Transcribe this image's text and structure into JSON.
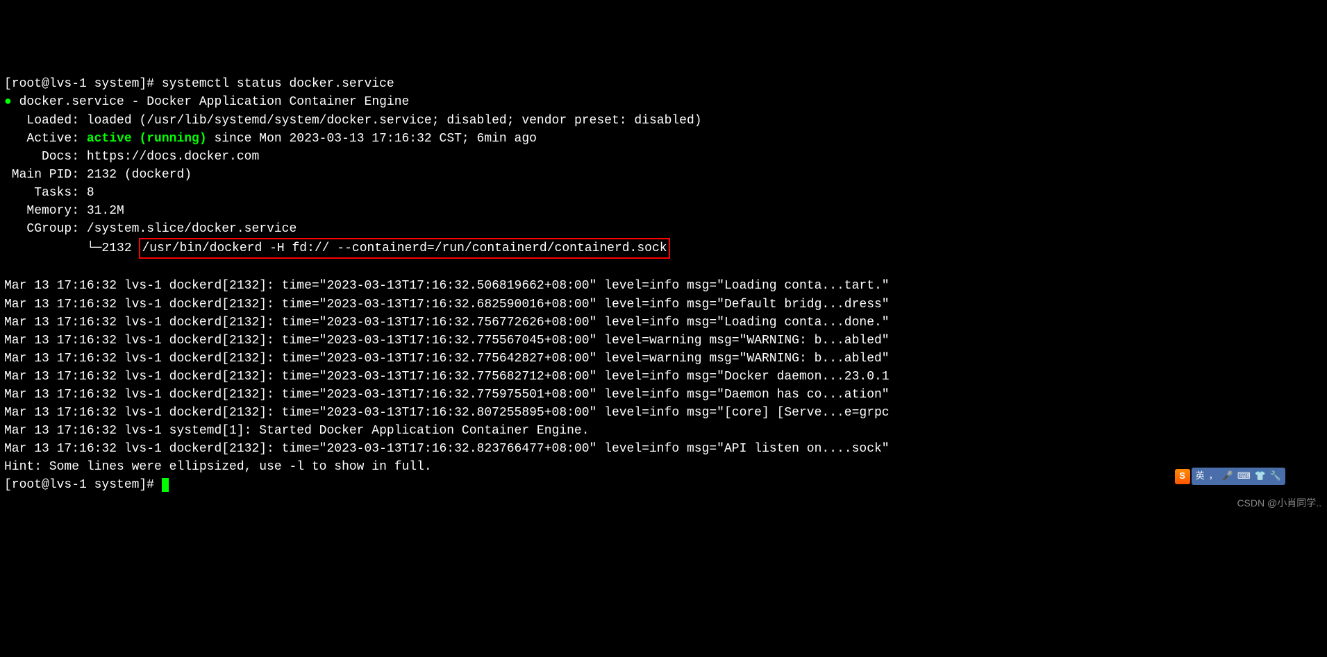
{
  "prompt1": "[root@lvs-1 system]# ",
  "cmd": "systemctl status docker.service",
  "bullet": "●",
  "svc_name": "docker.service",
  "svc_desc": " - Docker Application Container Engine",
  "loaded_lbl": "   Loaded: ",
  "loaded_val": "loaded (/usr/lib/systemd/system/docker.service; disabled; vendor preset: disabled)",
  "active_lbl": "   Active: ",
  "active_state": "active (running)",
  "active_since": " since Mon 2023-03-13 17:16:32 CST; 6min ago",
  "docs_lbl": "     Docs: ",
  "docs_val": "https://docs.docker.com",
  "pid_lbl": " Main PID: ",
  "pid_val": "2132 (dockerd)",
  "tasks_lbl": "    Tasks: ",
  "tasks_val": "8",
  "mem_lbl": "   Memory: ",
  "mem_val": "31.2M",
  "cgroup_lbl": "   CGroup: ",
  "cgroup_val": "/system.slice/docker.service",
  "tree_prefix": "           └─2132 ",
  "proc_cmd": "/usr/bin/dockerd -H fd:// --containerd=/run/containerd/containerd.sock",
  "logs": [
    "Mar 13 17:16:32 lvs-1 dockerd[2132]: time=\"2023-03-13T17:16:32.506819662+08:00\" level=info msg=\"Loading conta...tart.\"",
    "Mar 13 17:16:32 lvs-1 dockerd[2132]: time=\"2023-03-13T17:16:32.682590016+08:00\" level=info msg=\"Default bridg...dress\"",
    "Mar 13 17:16:32 lvs-1 dockerd[2132]: time=\"2023-03-13T17:16:32.756772626+08:00\" level=info msg=\"Loading conta...done.\"",
    "Mar 13 17:16:32 lvs-1 dockerd[2132]: time=\"2023-03-13T17:16:32.775567045+08:00\" level=warning msg=\"WARNING: b...abled\"",
    "Mar 13 17:16:32 lvs-1 dockerd[2132]: time=\"2023-03-13T17:16:32.775642827+08:00\" level=warning msg=\"WARNING: b...abled\"",
    "Mar 13 17:16:32 lvs-1 dockerd[2132]: time=\"2023-03-13T17:16:32.775682712+08:00\" level=info msg=\"Docker daemon...23.0.1",
    "Mar 13 17:16:32 lvs-1 dockerd[2132]: time=\"2023-03-13T17:16:32.775975501+08:00\" level=info msg=\"Daemon has co...ation\"",
    "Mar 13 17:16:32 lvs-1 dockerd[2132]: time=\"2023-03-13T17:16:32.807255895+08:00\" level=info msg=\"[core] [Serve...e=grpc",
    "Mar 13 17:16:32 lvs-1 systemd[1]: Started Docker Application Container Engine.",
    "Mar 13 17:16:32 lvs-1 dockerd[2132]: time=\"2023-03-13T17:16:32.823766477+08:00\" level=info msg=\"API listen on....sock\""
  ],
  "hint": "Hint: Some lines were ellipsized, use -l to show in full.",
  "prompt2": "[root@lvs-1 system]# ",
  "ime_logo": "S",
  "ime_text": "英",
  "watermark": "CSDN @小肖同学.."
}
